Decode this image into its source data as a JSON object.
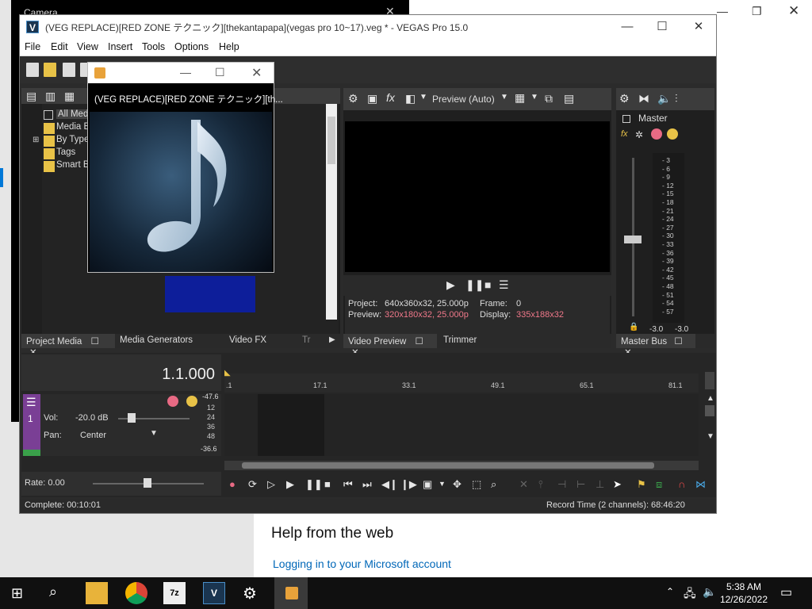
{
  "background": {
    "help_title": "Help from the web",
    "help_link": "Logging in to your Microsoft account"
  },
  "camera_window": {
    "title": "Camera"
  },
  "vegas": {
    "title": "(VEG REPLACE)[RED ZONE テクニック][thekantapapa](vegas pro 10~17).veg * - VEGAS Pro 15.0",
    "menu": [
      "File",
      "Edit",
      "View",
      "Insert",
      "Tools",
      "Options",
      "Help"
    ],
    "project_tree": [
      "All Media",
      "Media Bins",
      "By Type",
      "Tags",
      "Smart Bins"
    ],
    "preview": {
      "mode": "Preview (Auto)",
      "project_label": "Project:",
      "project_value": "640x360x32, 25.000p",
      "preview_label": "Preview:",
      "preview_value": "320x180x32, 25.000p",
      "frame_label": "Frame:",
      "frame_value": "0",
      "display_label": "Display:",
      "display_value": "335x188x32"
    },
    "master": {
      "label": "Master",
      "scale": [
        "3",
        "6",
        "9",
        "12",
        "15",
        "18",
        "21",
        "24",
        "27",
        "30",
        "33",
        "36",
        "39",
        "42",
        "45",
        "48",
        "51",
        "54",
        "57"
      ],
      "left_db": "-3.0",
      "right_db": "-3.0"
    },
    "tabs": {
      "project_media": "Project Media",
      "media_generators": "Media Generators",
      "video_fx": "Video FX",
      "transitions": "Tr",
      "video_preview": "Video Preview",
      "trimmer": "Trimmer",
      "master_bus": "Master Bus"
    },
    "timeline": {
      "timecode": "1.1.000",
      "ruler": [
        ".1",
        "17.1",
        "33.1",
        "49.1",
        "65.1",
        "81.1"
      ],
      "track": {
        "vol_label": "Vol:",
        "vol_value": "-20.0 dB",
        "pan_label": "Pan:",
        "pan_value": "Center",
        "meter_top": "-47.6",
        "meter_scale": [
          "12",
          "24",
          "36",
          "48"
        ],
        "meter_bottom": "-36.6",
        "number": "1"
      },
      "rate": "Rate: 0.00"
    },
    "status": {
      "complete": "Complete: 00:10:01",
      "record_time": "Record Time (2 channels): 68:46:20"
    }
  },
  "popup": {
    "caption": "(VEG REPLACE)[RED ZONE テクニック][th..."
  },
  "taskbar": {
    "time": "5:38 AM",
    "date": "12/26/2022"
  }
}
